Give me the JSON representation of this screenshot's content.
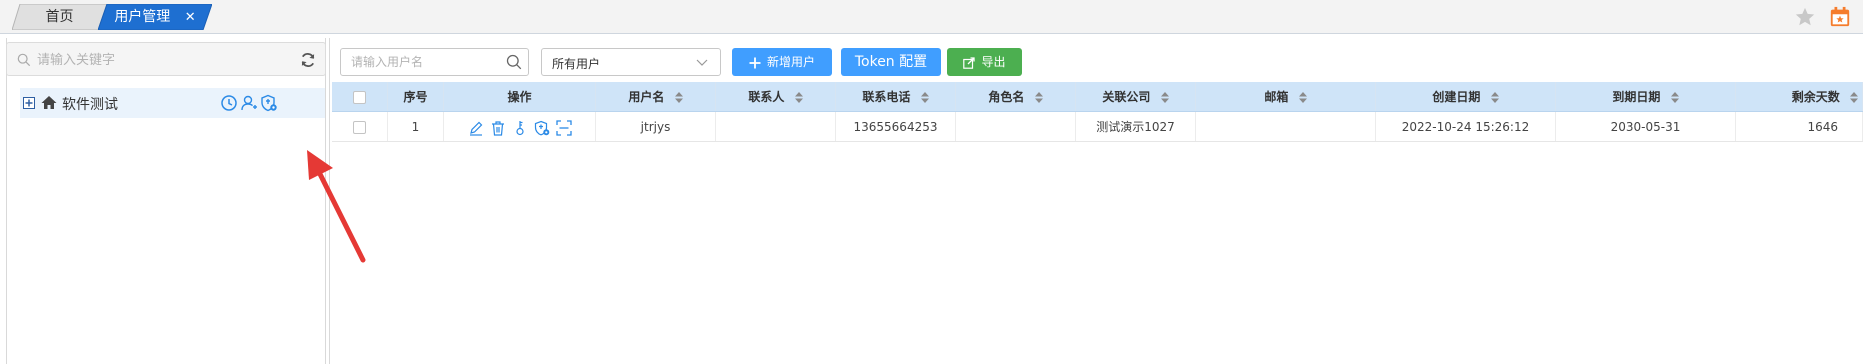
{
  "tabs": {
    "home": "首页",
    "users": "用户管理",
    "close": "✕"
  },
  "left": {
    "search_placeholder": "请输入关键字",
    "tree_node_label": "软件测试"
  },
  "toolbar": {
    "search_placeholder": "请输入用户名",
    "filter_selected": "所有用户",
    "add_label": "新增用户",
    "token_label": "Token 配置",
    "export_label": "导出"
  },
  "table": {
    "headers": {
      "index": "序号",
      "ops": "操作",
      "username": "用户名",
      "contact": "联系人",
      "phone": "联系电话",
      "role": "角色名",
      "company": "关联公司",
      "email": "邮箱",
      "created": "创建日期",
      "expire": "到期日期",
      "remaining": "剩余天数"
    },
    "rows": [
      {
        "index": "1",
        "username": "jtrjys",
        "contact": "",
        "phone": "13655664253",
        "role": "",
        "company": "测试演示1027",
        "email": "",
        "created": "2022-10-24 15:26:12",
        "expire": "2030-05-31",
        "remaining": "1646"
      }
    ]
  },
  "colors": {
    "accent": "#409eff",
    "tab_active": "#1e6fd1",
    "export": "#4caf50",
    "annotation": "#e53935"
  }
}
